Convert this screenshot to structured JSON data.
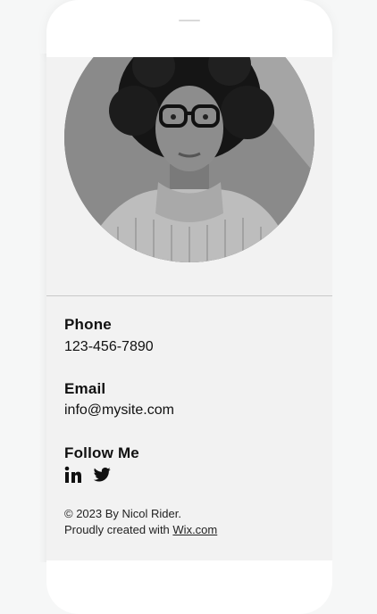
{
  "contact": {
    "phone_label": "Phone",
    "phone_value": "123-456-7890",
    "email_label": "Email",
    "email_value": "info@mysite.com",
    "follow_label": "Follow Me"
  },
  "social": [
    {
      "icon": "linkedin-icon"
    },
    {
      "icon": "twitter-icon"
    }
  ],
  "footer": {
    "copyright": "© 2023 By Nicol Rider.",
    "created_prefix": "Proudly created with",
    "link_text": "Wix.com"
  }
}
